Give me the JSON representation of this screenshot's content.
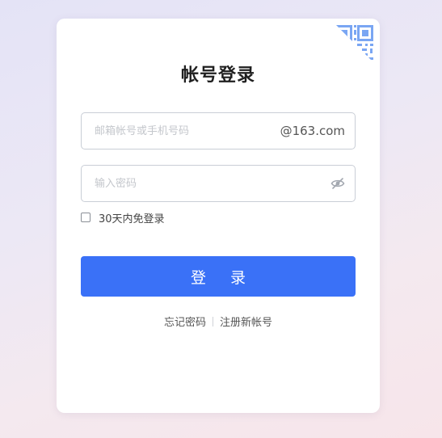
{
  "login": {
    "title": "帐号登录",
    "email": {
      "placeholder": "邮箱帐号或手机号码",
      "value": "",
      "suffix": "@163.com"
    },
    "password": {
      "placeholder": "输入密码",
      "value": "",
      "visibility_icon": "eye-off-icon"
    },
    "remember": {
      "label": "30天内免登录",
      "checked": false
    },
    "submit_label": "登 录",
    "forgot_link": "忘记密码",
    "register_link": "注册新帐号",
    "qr_toggle_icon": "qr-code-icon"
  },
  "colors": {
    "accent": "#3a71f7",
    "qr": "#7aa6f3"
  }
}
